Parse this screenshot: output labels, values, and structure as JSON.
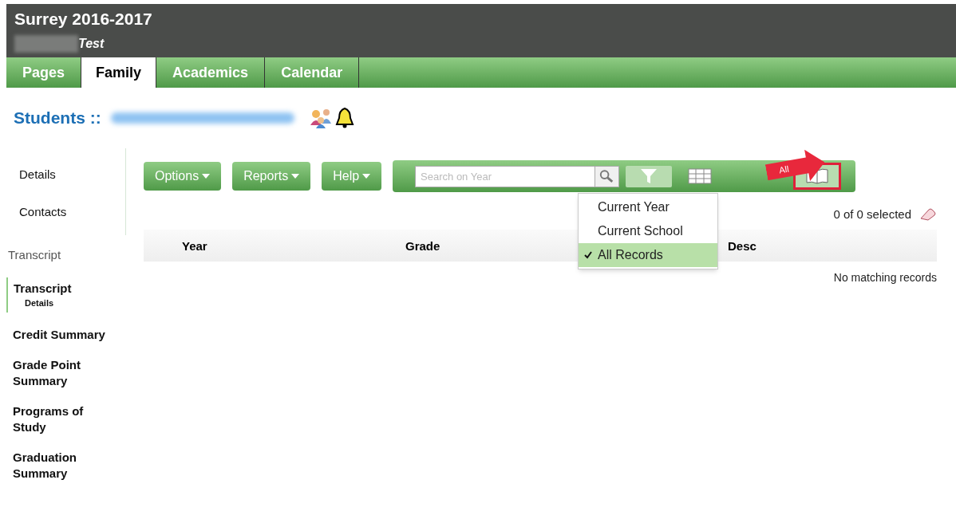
{
  "header": {
    "title": "Surrey 2016-2017",
    "subtitle": "Test"
  },
  "tabs": [
    {
      "label": "Pages",
      "selected": false
    },
    {
      "label": "Family",
      "selected": true
    },
    {
      "label": "Academics",
      "selected": false
    },
    {
      "label": "Calendar",
      "selected": false
    }
  ],
  "breadcrumb": {
    "label": "Students ::"
  },
  "side_nav": {
    "top_items": [
      {
        "label": "Details"
      },
      {
        "label": "Contacts"
      }
    ],
    "section": "Transcript",
    "items": [
      {
        "label": "Transcript",
        "sublabel": "Details",
        "selected": true
      },
      {
        "label": "Credit Summary",
        "selected": false
      },
      {
        "label": "Grade Point Summary",
        "selected": false
      },
      {
        "label": "Programs of Study",
        "selected": false
      },
      {
        "label": "Graduation Summary",
        "selected": false
      }
    ]
  },
  "toolbar": {
    "buttons": [
      {
        "label": "Options"
      },
      {
        "label": "Reports"
      },
      {
        "label": "Help"
      }
    ],
    "search": {
      "placeholder": "Search on Year"
    },
    "filter_menu": [
      {
        "label": "Current Year",
        "checked": false
      },
      {
        "label": "Current School",
        "checked": false
      },
      {
        "label": "All Records",
        "checked": true
      }
    ],
    "callout": "All"
  },
  "selection": "0 of 0 selected",
  "table": {
    "columns": [
      "Year",
      "Grade",
      "Desc"
    ],
    "empty_message": "No matching records"
  }
}
